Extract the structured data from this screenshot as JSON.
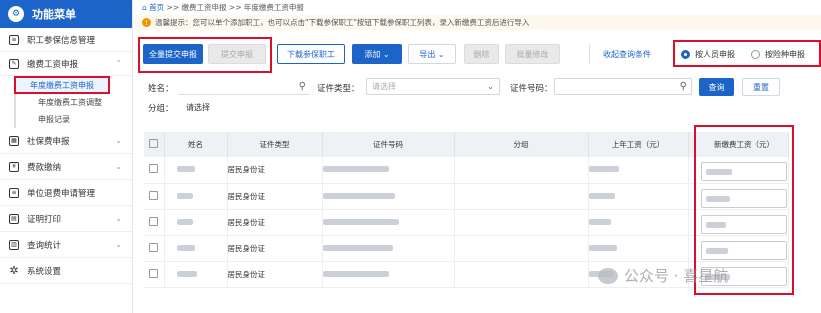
{
  "sidebar": {
    "title": "功能菜单",
    "items": [
      {
        "label": "职工参保信息管理",
        "icon": "doc-icon"
      },
      {
        "label": "缴费工资申报",
        "icon": "edit-icon"
      },
      {
        "label": "社保费申报",
        "icon": "calendar-icon"
      },
      {
        "label": "费款缴纳",
        "icon": "money-icon"
      },
      {
        "label": "单位退费申请管理",
        "icon": "list-icon"
      },
      {
        "label": "证明打印",
        "icon": "printer-icon"
      },
      {
        "label": "查询统计",
        "icon": "chart-icon"
      },
      {
        "label": "系统设置",
        "icon": "gear-icon"
      }
    ],
    "subitems": [
      "年度缴费工资申报",
      "年度缴费工资调整",
      "申报记录"
    ]
  },
  "breadcrumb": {
    "home": "首页",
    "sep1": ">>",
    "level1": "缴费工资申报",
    "sep2": ">>",
    "level2": "年度缴费工资申报"
  },
  "tip": "温馨提示：您可以单个添加职工，也可以点击\"下载参保职工\"按钮下载参保职工列表，录入新缴费工资后进行导入",
  "toolbar": {
    "submit_all": "全量提交申报",
    "submit": "提交申报",
    "download": "下载参保职工",
    "add": "添加",
    "export": "导出",
    "delete": "删除",
    "batch_edit": "批量修改",
    "collapse": "收起查询条件",
    "radio_person": "按人员申报",
    "radio_insurance": "按险种申报"
  },
  "filter": {
    "name_label": "姓名：",
    "cert_type_label": "证件类型：",
    "cert_type_placeholder": "请选择",
    "cert_no_label": "证件号码：",
    "group_label": "分组：",
    "group_placeholder": "请选择",
    "query": "查询",
    "reset": "重置"
  },
  "table": {
    "headers": [
      "姓名",
      "证件类型",
      "证件号码",
      "分组",
      "上年工资（元）",
      "新缴费工资（元）"
    ],
    "rows": [
      {
        "cert_type": "居民身份证"
      },
      {
        "cert_type": "居民身份证"
      },
      {
        "cert_type": "居民身份证"
      },
      {
        "cert_type": "居民身份证"
      },
      {
        "cert_type": "居民身份证"
      }
    ]
  },
  "watermark": "公众号 · 喜星航"
}
